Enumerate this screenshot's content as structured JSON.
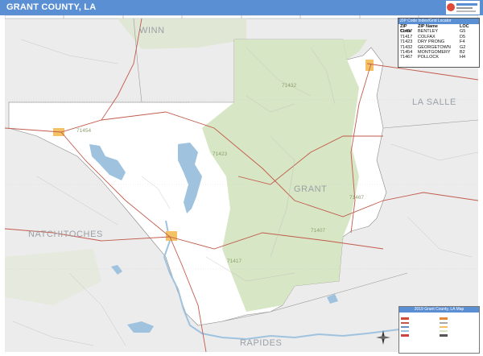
{
  "title": "GRANT COUNTY, LA",
  "colors": {
    "title_bar": "#5b8fd4",
    "county_fill": "#ffffff",
    "outside_fill": "#ececec",
    "forest": "#d7e6c4",
    "water": "#9fc3df",
    "urban": "#f3c265",
    "road_major": "#c25a4c",
    "road_minor": "#bcbcbc",
    "county_line": "#999999"
  },
  "labels": {
    "counties": [
      "WINN",
      "LA SALLE",
      "GRANT",
      "NATCHITOCHES",
      "RAPIDES"
    ],
    "zips": [
      "71432",
      "71454",
      "71423",
      "71467",
      "71407",
      "71417"
    ]
  },
  "zip_table": {
    "header": "ZIP Code Index/Grid Locator",
    "columns": [
      "ZIP Code",
      "ZIP Name",
      "LOC"
    ],
    "rows": [
      [
        "71407",
        "BENTLEY",
        "G5"
      ],
      [
        "71417",
        "COLFAX",
        "D5"
      ],
      [
        "71423",
        "DRY PRONG",
        "F4"
      ],
      [
        "71432",
        "GEORGETOWN",
        "G2"
      ],
      [
        "71454",
        "MONTGOMERY",
        "B2"
      ],
      [
        "71467",
        "POLLOCK",
        "H4"
      ]
    ]
  },
  "legend": {
    "title": "2019 Grant County, LA Map",
    "items": [
      {
        "color": "#d04a3a"
      },
      {
        "color": "#e08a3a"
      },
      {
        "color": "#c25a4c"
      },
      {
        "color": "#aaaaaa"
      },
      {
        "color": "#6a8fc0"
      },
      {
        "color": "#f3c265"
      },
      {
        "color": "#9fc3df"
      },
      {
        "color": "#d7e6c4"
      },
      {
        "color": "#cc4444"
      },
      {
        "color": "#555555"
      }
    ]
  },
  "icons": {
    "compass": "compass-rose-icon",
    "logo": "publisher-logo-icon"
  }
}
